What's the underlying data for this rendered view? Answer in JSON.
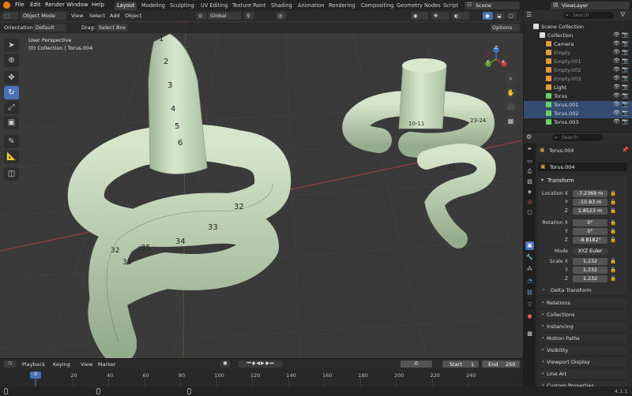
{
  "topbar": {
    "menus": [
      "File",
      "Edit",
      "Render",
      "Window",
      "Help"
    ],
    "workspaces": [
      "Layout",
      "Modeling",
      "Sculpting",
      "UV Editing",
      "Texture Paint",
      "Shading",
      "Animation",
      "Rendering",
      "Compositing",
      "Geometry Nodes",
      "Script"
    ],
    "scene": "Scene",
    "view_layer": "ViewLayer"
  },
  "viewport": {
    "mode": "Object Mode",
    "view": "View",
    "select": "Select",
    "add": "Add",
    "object": "Object",
    "transform_orientation": "Global",
    "orientation_label": "Orientation:",
    "orientation_value": "Default",
    "drag_label": "Drag:",
    "drag_value": "Select Box",
    "options": "Options",
    "info_line1": "User Perspective",
    "info_line2": "(0) Collection | Torus.004",
    "axis": {
      "x": "X",
      "y": "Y",
      "z": "Z"
    },
    "digits_left": [
      "1",
      "2",
      "3",
      "4",
      "5",
      "6"
    ],
    "numbers_left": [
      "32",
      "33",
      "34",
      "35",
      "32",
      "33"
    ],
    "numbers_right": [
      "35",
      "10-11",
      "23-24"
    ]
  },
  "outliner": {
    "search_placeholder": "Search",
    "rows": [
      {
        "name": "Scene Collection",
        "level": 0,
        "color": "#ffffff"
      },
      {
        "name": "Collection",
        "level": 1,
        "color": "#ffffff"
      },
      {
        "name": "Camera",
        "level": 2,
        "color": "#e39a3b"
      },
      {
        "name": "Empty",
        "level": 2,
        "color": "#e39a3b"
      },
      {
        "name": "Empty.001",
        "level": 2,
        "color": "#e39a3b"
      },
      {
        "name": "Empty.002",
        "level": 2,
        "color": "#e39a3b"
      },
      {
        "name": "Empty.003",
        "level": 2,
        "color": "#e39a3b"
      },
      {
        "name": "Light",
        "level": 2,
        "color": "#e39a3b"
      },
      {
        "name": "Torus",
        "level": 2,
        "color": "#e39a3b"
      },
      {
        "name": "Torus.001",
        "level": 2,
        "color": "#e39a3b"
      },
      {
        "name": "Torus.002",
        "level": 2,
        "color": "#e39a3b"
      },
      {
        "name": "Torus.003",
        "level": 2,
        "color": "#e39a3b"
      }
    ]
  },
  "properties": {
    "search_placeholder": "Search",
    "object_name": "Torus.004",
    "object_field": "Torus.004",
    "transform": "Transform",
    "location_label": "Location X",
    "loc_x": "-7.2369 m",
    "loc_y": "-10.83 m",
    "loc_z": "1.8523 m",
    "rotation_label": "Rotation X",
    "rot_x": "0°",
    "rot_y": "0°",
    "rot_z": "-8.8182°",
    "mode_label": "Mode",
    "mode_value": "XYZ Euler",
    "scale_label": "Scale X",
    "scale_x": "1.232",
    "scale_y": "1.232",
    "scale_z": "1.232",
    "y_label": "Y",
    "z_label": "Z",
    "delta": "Delta Transform",
    "panels": [
      "Relations",
      "Collections",
      "Instancing",
      "Motion Paths",
      "Visibility",
      "Viewport Display",
      "Line Art",
      "Custom Properties"
    ]
  },
  "timeline": {
    "playback": "Playback",
    "keying": "Keying",
    "view": "View",
    "marker": "Marker",
    "current_frame": "0",
    "start_label": "Start",
    "start": "1",
    "end_label": "End",
    "end": "250",
    "ticks": [
      "0",
      "20",
      "40",
      "60",
      "80",
      "100",
      "120",
      "140",
      "160",
      "180",
      "200",
      "220",
      "240"
    ],
    "playhead": "0"
  },
  "statusbar": {
    "version": "4.1.1"
  },
  "colors": {
    "accent": "#4772b3",
    "mesh": "#c9dcc0",
    "grid": "#474747"
  }
}
